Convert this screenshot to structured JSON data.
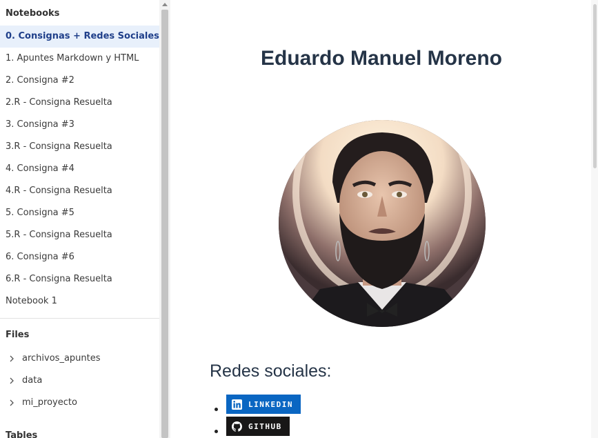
{
  "sidebar": {
    "notebooks_title": "Notebooks",
    "notebooks": [
      {
        "label": "0. Consignas + Redes Sociales",
        "active": true
      },
      {
        "label": "1. Apuntes Markdown y HTML"
      },
      {
        "label": "2. Consigna #2"
      },
      {
        "label": "2.R - Consigna Resuelta"
      },
      {
        "label": "3. Consigna #3"
      },
      {
        "label": "3.R - Consigna Resuelta"
      },
      {
        "label": "4. Consigna #4"
      },
      {
        "label": "4.R - Consigna Resuelta"
      },
      {
        "label": "5. Consigna #5"
      },
      {
        "label": "5.R - Consigna Resuelta"
      },
      {
        "label": "6. Consigna #6"
      },
      {
        "label": "6.R - Consigna Resuelta"
      },
      {
        "label": "Notebook 1"
      }
    ],
    "files_title": "Files",
    "files": [
      {
        "label": "archivos_apuntes",
        "icon": "chevron-right-icon"
      },
      {
        "label": "data",
        "icon": "chevron-right-icon"
      },
      {
        "label": "mi_proyecto",
        "icon": "chevron-right-icon"
      }
    ],
    "cut_section_title": "Tables"
  },
  "main": {
    "title": "Eduardo Manuel Moreno",
    "portrait_icon": "profile-portrait-image",
    "social_heading": "Redes sociales:",
    "badges": [
      {
        "label": "LINKEDIN",
        "icon": "linkedin-icon",
        "color": "#0a66c2"
      },
      {
        "label": "GITHUB",
        "icon": "github-icon",
        "color": "#181717"
      }
    ]
  },
  "colors": {
    "active_item_bg": "#e8f0fb",
    "active_item_text": "#1f3f8a",
    "heading": "#253447"
  }
}
